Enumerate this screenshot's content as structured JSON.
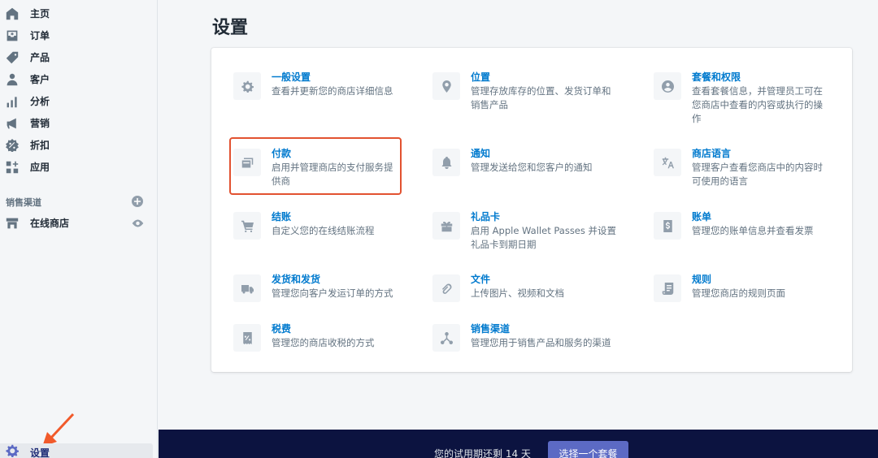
{
  "sidebar": {
    "items": [
      {
        "label": "主页",
        "icon": "home-icon"
      },
      {
        "label": "订单",
        "icon": "orders-icon"
      },
      {
        "label": "产品",
        "icon": "tag-icon"
      },
      {
        "label": "客户",
        "icon": "customer-icon"
      },
      {
        "label": "分析",
        "icon": "analytics-icon"
      },
      {
        "label": "营销",
        "icon": "megaphone-icon"
      },
      {
        "label": "折扣",
        "icon": "discount-icon"
      },
      {
        "label": "应用",
        "icon": "apps-icon"
      }
    ],
    "channels_title": "销售渠道",
    "channels": [
      {
        "label": "在线商店",
        "icon": "store-icon"
      }
    ],
    "settings_label": "设置"
  },
  "page": {
    "title": "设置"
  },
  "settings": [
    {
      "title": "一般设置",
      "desc": [
        "查看并更新您的商店详细信息"
      ],
      "icon": "gear-icon"
    },
    {
      "title": "位置",
      "desc": [
        "管理存放库存的位置、发货订单和",
        "销售产品"
      ],
      "icon": "location-pin-icon"
    },
    {
      "title": "套餐和权限",
      "desc": [
        "查看套餐信息，并管理员工可在",
        "您商店中查看的内容或执行的操",
        "作"
      ],
      "icon": "account-icon"
    },
    {
      "title": "付款",
      "desc": [
        "启用并管理商店的支付服务提",
        "供商"
      ],
      "icon": "payment-card-icon"
    },
    {
      "title": "通知",
      "desc": [
        "管理发送给您和您客户的通知"
      ],
      "icon": "bell-icon"
    },
    {
      "title": "商店语言",
      "desc": [
        "管理客户查看您商店中的内容时",
        "可使用的语言"
      ],
      "icon": "translate-icon"
    },
    {
      "title": "结账",
      "desc": [
        "自定义您的在线结账流程"
      ],
      "icon": "cart-icon"
    },
    {
      "title": "礼品卡",
      "desc": [
        "启用 Apple Wallet Passes 并设置",
        "礼品卡到期日期"
      ],
      "icon": "gift-icon"
    },
    {
      "title": "账单",
      "desc": [
        "管理您的账单信息并查看发票"
      ],
      "icon": "billing-icon"
    },
    {
      "title": "发货和发货",
      "desc": [
        "管理您向客户发运订单的方式"
      ],
      "icon": "truck-icon"
    },
    {
      "title": "文件",
      "desc": [
        "上传图片、视频和文档"
      ],
      "icon": "paperclip-icon"
    },
    {
      "title": "规则",
      "desc": [
        "管理您商店的规则页面"
      ],
      "icon": "policy-icon"
    },
    {
      "title": "税费",
      "desc": [
        "管理您的商店收税的方式"
      ],
      "icon": "tax-icon"
    },
    {
      "title": "销售渠道",
      "desc": [
        "管理您用于销售产品和服务的渠道"
      ],
      "icon": "channels-icon"
    }
  ],
  "trial": {
    "text": "您的试用期还剩 14 天",
    "button": "选择一个套餐"
  },
  "colors": {
    "accent": "#5c6ac4",
    "link": "#007ace",
    "highlight": "#e25230",
    "trial_bar": "#0c1340"
  }
}
